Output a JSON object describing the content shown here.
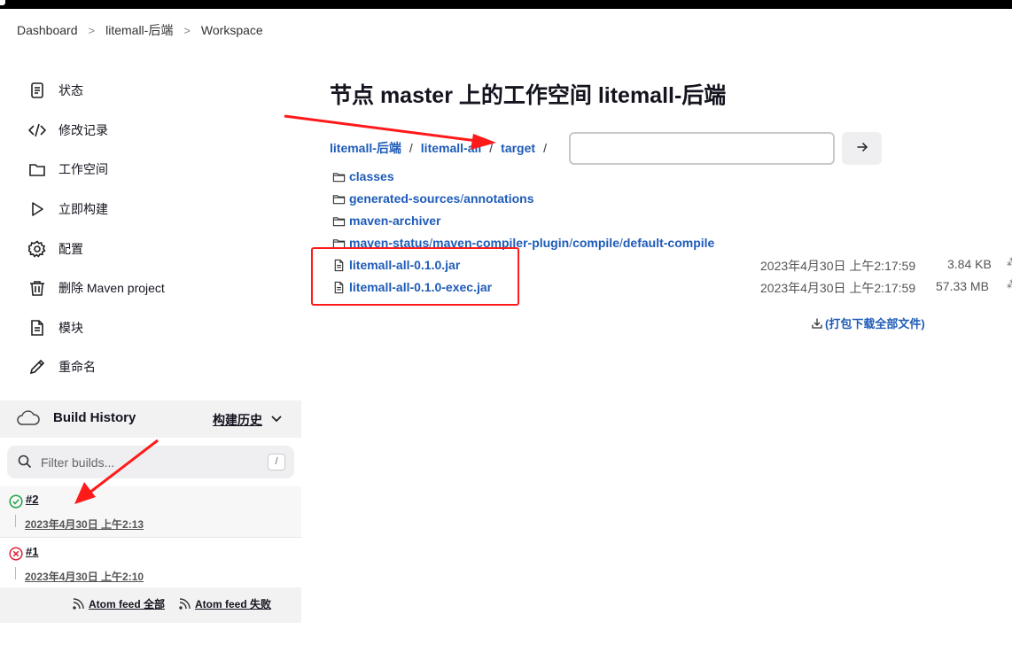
{
  "breadcrumb": [
    "Dashboard",
    "litemall-后端",
    "Workspace"
  ],
  "breadcrumb_sep": ">",
  "tasks": [
    {
      "label": "状态",
      "icon": "status-doc-icon"
    },
    {
      "label": "修改记录",
      "icon": "code-icon"
    },
    {
      "label": "工作空间",
      "icon": "folder-icon"
    },
    {
      "label": "立即构建",
      "icon": "play-icon"
    },
    {
      "label": "配置",
      "icon": "gear-icon"
    },
    {
      "label": "删除 Maven project",
      "icon": "trash-icon"
    },
    {
      "label": "模块",
      "icon": "document-icon"
    },
    {
      "label": "重命名",
      "icon": "pencil-icon"
    }
  ],
  "build_history": {
    "title": "Build History",
    "trend_label": "构建历史",
    "filter_placeholder": "Filter builds...",
    "filter_shortcut": "/",
    "builds": [
      {
        "number": "#2",
        "date": "2023年4月30日 上午2:13",
        "status": "success"
      },
      {
        "number": "#1",
        "date": "2023年4月30日 上午2:10",
        "status": "failed"
      }
    ],
    "feeds": [
      "Atom feed 全部",
      "Atom feed 失败"
    ]
  },
  "workspace": {
    "title": "节点 master 上的工作空间 litemall-后端",
    "path": [
      "litemall-后端",
      "litemall-all",
      "target"
    ],
    "path_sep": "/",
    "path_input_value": "",
    "go_button_icon": "arrow-right-icon",
    "folders": [
      [
        "classes"
      ],
      [
        "generated-sources",
        "annotations"
      ],
      [
        "maven-archiver"
      ],
      [
        "maven-status",
        "maven-compiler-plugin",
        "compile",
        "default-compile"
      ]
    ],
    "files": [
      {
        "name": "litemall-all-0.1.0.jar",
        "date": "2023年4月30日 上午2:17:59",
        "size": "3.84 KB"
      },
      {
        "name": "litemall-all-0.1.0-exec.jar",
        "date": "2023年4月30日 上午2:17:59",
        "size": "57.33 MB"
      }
    ],
    "download_all": "(打包下载全部文件)"
  },
  "colors": {
    "link": "#1e5bb8",
    "annotation": "#ff1a1a",
    "success": "#1ea446",
    "failed": "#e0243a"
  }
}
